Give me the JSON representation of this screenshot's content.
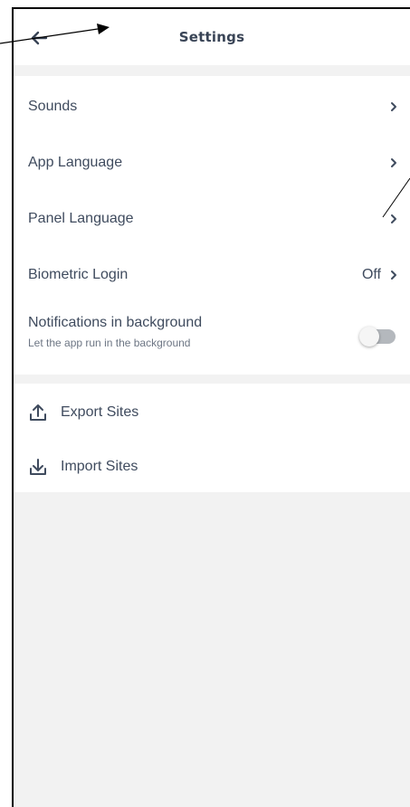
{
  "header": {
    "title": "Settings",
    "back_icon": "arrow-left-icon"
  },
  "settings": {
    "items": [
      {
        "label": "Sounds"
      },
      {
        "label": "App Language"
      },
      {
        "label": "Panel Language"
      },
      {
        "label": "Biometric Login",
        "value": "Off"
      }
    ],
    "notifications": {
      "label": "Notifications in background",
      "subtitle": "Let the app run in the background",
      "enabled": false
    }
  },
  "actions": {
    "export_label": "Export Sites",
    "import_label": "Import Sites"
  },
  "colors": {
    "text": "#3f4b5e",
    "title": "#394456",
    "background": "#f2f2f2",
    "toggle_off": "#b4b8bd"
  }
}
